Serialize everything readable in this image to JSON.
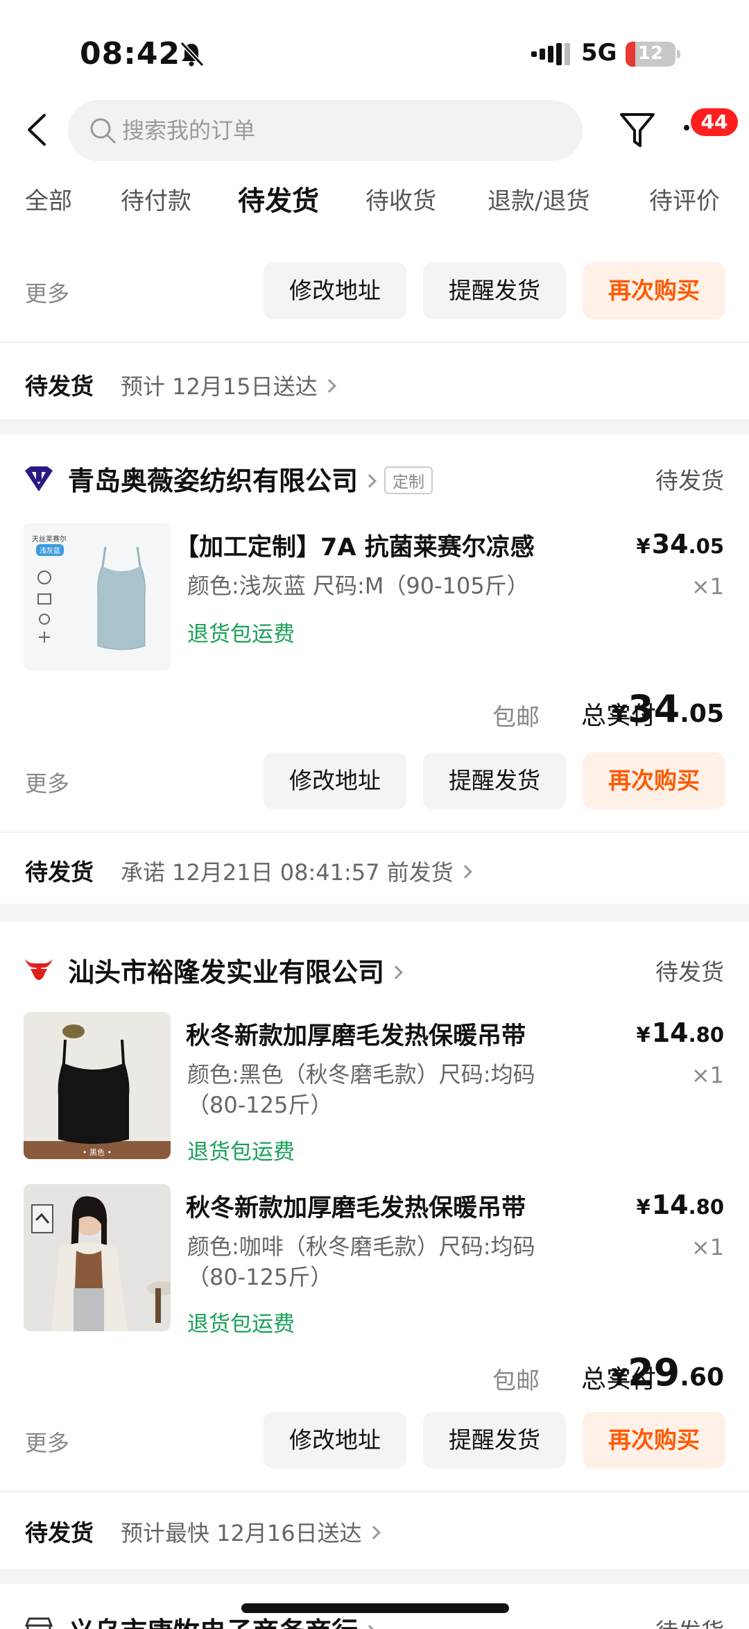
{
  "status_bar": {
    "time": "08:42",
    "network": "5G",
    "battery": "12"
  },
  "header": {
    "search_placeholder": "搜索我的订单",
    "message_badge": "44"
  },
  "tabs": [
    {
      "label": "全部"
    },
    {
      "label": "待付款"
    },
    {
      "label": "待发货",
      "active": true
    },
    {
      "label": "待收货"
    },
    {
      "label": "退款/退货"
    },
    {
      "label": "待评价"
    }
  ],
  "actions": {
    "more": "更多",
    "modify_address": "修改地址",
    "remind_ship": "提醒发货",
    "buy_again": "再次购买"
  },
  "order0": {
    "status": "待发货",
    "info": "预计 12月15日送达"
  },
  "order1": {
    "shop_name": "青岛奥薇姿纺织有限公司",
    "shop_tag": "定制",
    "status": "待发货",
    "items": [
      {
        "title": "【加工定制】7A 抗菌莱赛尔凉感",
        "spec": "颜色:浅灰蓝 尺码:M（90-105斤）",
        "return": "退货包运费",
        "currency": "¥",
        "price_int": "34",
        "price_dec": ".05",
        "qty": "×1",
        "thumb_text_1": "天丝莱赛尔",
        "thumb_text_2": "浅灰蓝"
      }
    ],
    "shipping": "包邮",
    "total_label": "总实付",
    "total_currency": "¥",
    "total_int": "34",
    "total_dec": ".05",
    "footer_status": "待发货",
    "footer_info": "承诺 12月21日 08:41:57 前发货"
  },
  "order2": {
    "shop_name": "汕头市裕隆发实业有限公司",
    "status": "待发货",
    "items": [
      {
        "title": "秋冬新款加厚磨毛发热保暖吊带",
        "spec": "颜色:黑色（秋冬磨毛款）尺码:均码（80-125斤）",
        "return": "退货包运费",
        "currency": "¥",
        "price_int": "14",
        "price_dec": ".80",
        "qty": "×1",
        "thumb_text": "• 黑色 •"
      },
      {
        "title": "秋冬新款加厚磨毛发热保暖吊带",
        "spec": "颜色:咖啡（秋冬磨毛款）尺码:均码（80-125斤）",
        "return": "退货包运费",
        "currency": "¥",
        "price_int": "14",
        "price_dec": ".80",
        "qty": "×1"
      }
    ],
    "shipping": "包邮",
    "total_label": "总实付",
    "total_currency": "¥",
    "total_int": "29",
    "total_dec": ".60",
    "footer_status": "待发货",
    "footer_info": "预计最快 12月16日送达"
  },
  "order3": {
    "shop_name": "义乌市唐牧电子商务商行",
    "status": "待发货"
  },
  "colors": {
    "accent": "#ff5a00",
    "accent_bg": "#fff1e8",
    "return_green": "#18a058",
    "badge_red": "#ff1f1f"
  }
}
